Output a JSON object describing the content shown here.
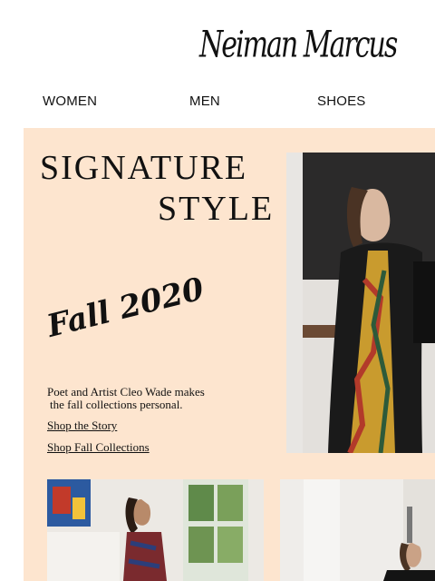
{
  "brand": {
    "logo_text": "Neiman Marcus"
  },
  "nav": {
    "items": [
      {
        "label": "WOMEN"
      },
      {
        "label": "MEN"
      },
      {
        "label": "SHOES"
      }
    ]
  },
  "hero": {
    "title_line1": "SIGNATURE",
    "title_line2": "STYLE",
    "season": "Fall 2020",
    "description_line1": "Poet and Artist Cleo Wade makes",
    "description_line2": "the fall collections personal.",
    "links": [
      {
        "label": "Shop the Story"
      },
      {
        "label": "Shop Fall Collections"
      }
    ]
  },
  "colors": {
    "hero_background": "#fde5cf",
    "text": "#111111"
  }
}
